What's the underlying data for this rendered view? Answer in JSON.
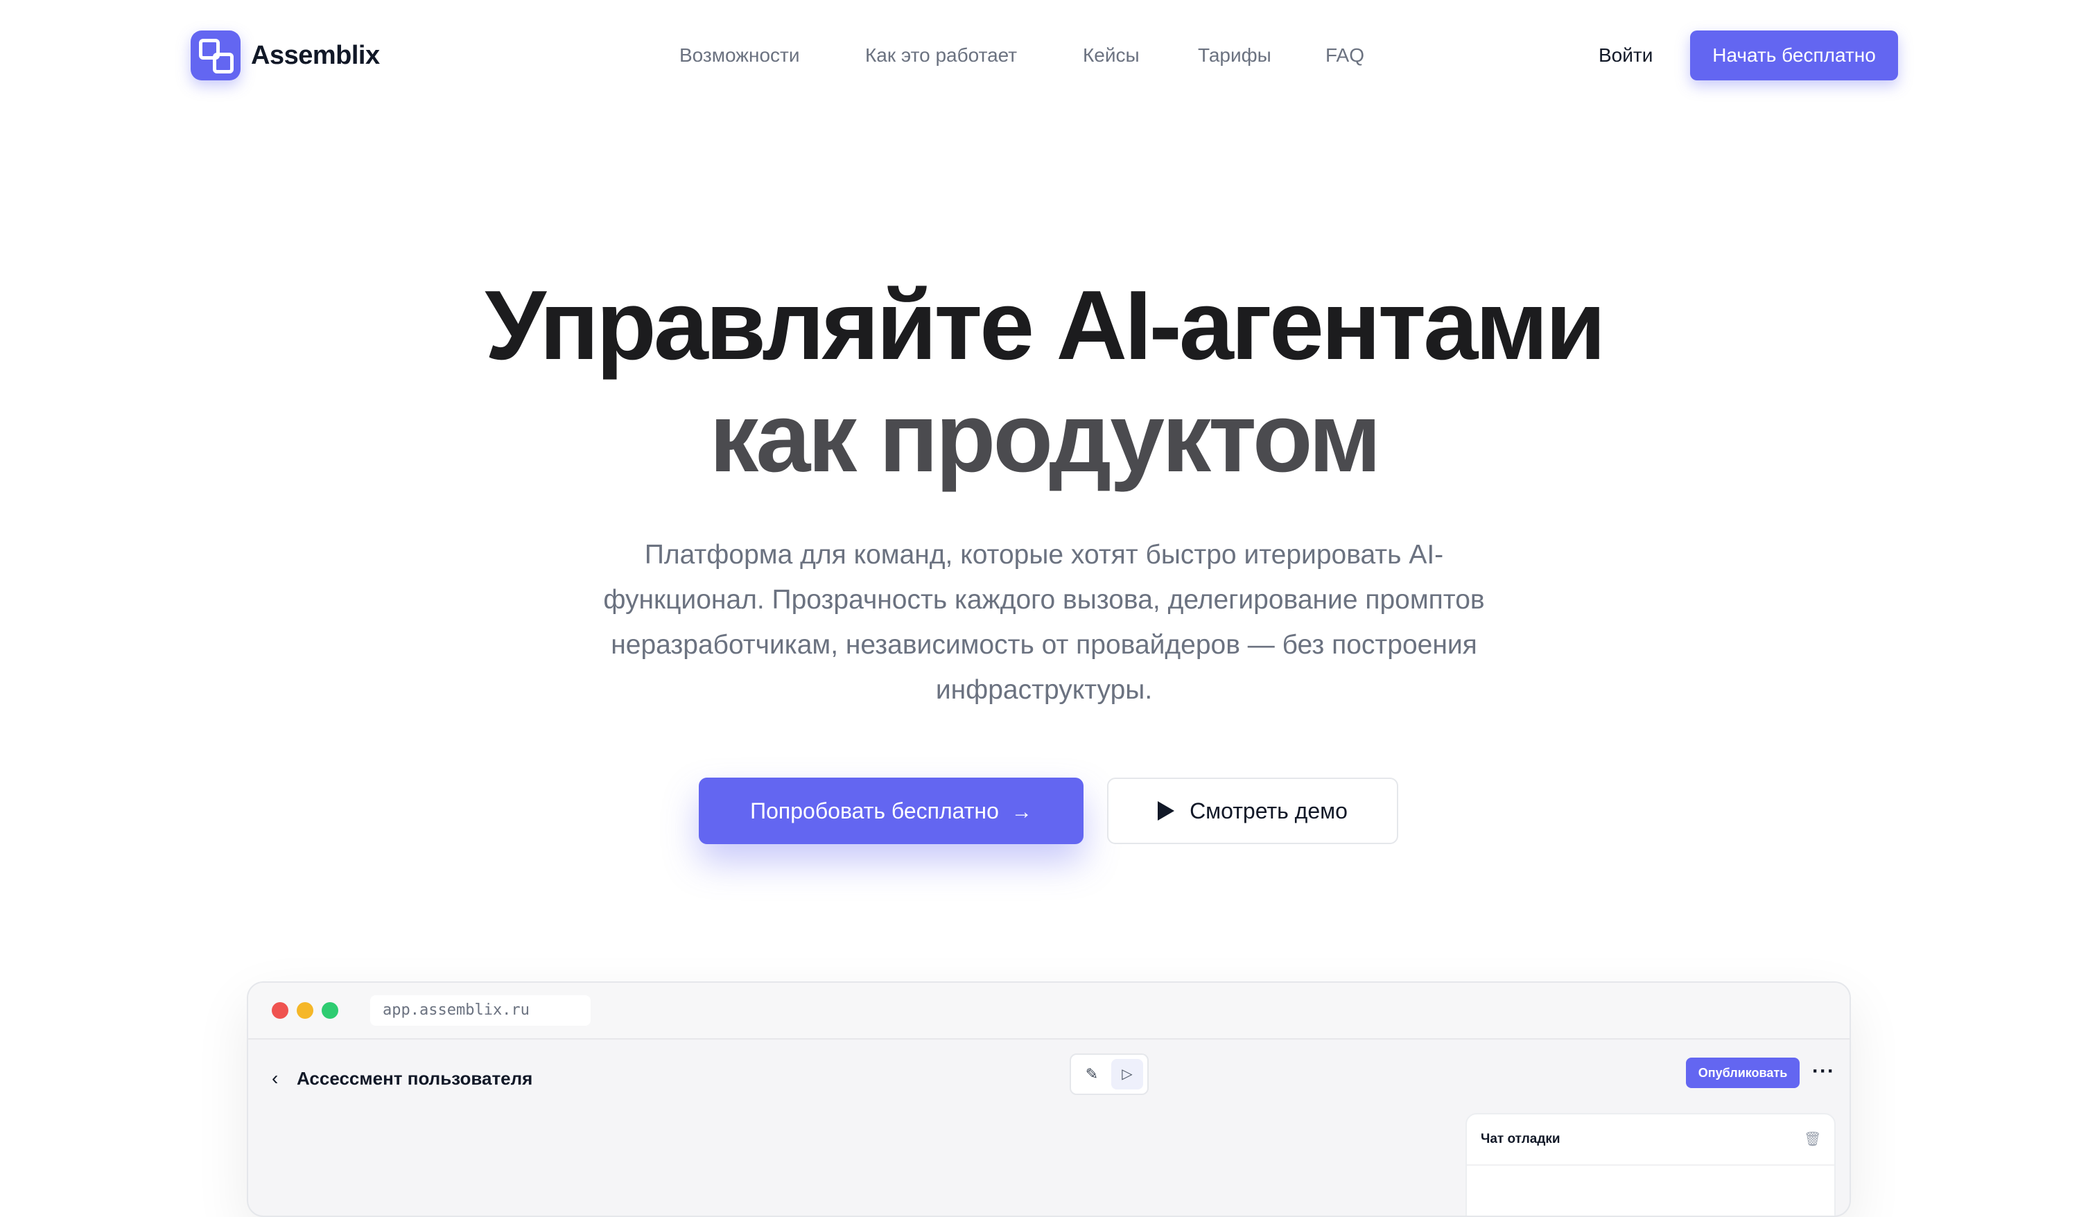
{
  "header": {
    "brand": "Assemblix",
    "nav": [
      {
        "label": "Возможности"
      },
      {
        "label": "Как это работает"
      },
      {
        "label": "Кейсы"
      },
      {
        "label": "Тарифы"
      },
      {
        "label": "FAQ"
      }
    ],
    "login_label": "Войти",
    "cta_label": "Начать бесплатно"
  },
  "hero": {
    "title_line1": "Управляйте AI-агентами",
    "title_line2": "как продуктом",
    "subtitle": "Платформа для команд, которые хотят быстро итерировать AI-функционал. Прозрачность каждого вызова, делегирование промптов неразработчикам, независимость от провайдеров — без построения инфраструктуры.",
    "primary_button": "Попробовать бесплатно",
    "primary_button_icon": "arrow-right-icon",
    "secondary_button": "Смотреть демо",
    "secondary_button_icon": "play-icon"
  },
  "app_preview": {
    "url": "app.assemblix.ru",
    "page_title": "Ассессмент пользователя",
    "publish_label": "Опубликовать",
    "debug_panel_title": "Чат отладки",
    "icons": [
      "back-chevron-icon",
      "edit-icon",
      "run-icon",
      "more-icon",
      "trash-icon"
    ]
  },
  "colors": {
    "accent": "#6366f1",
    "title_dark": "#1c1c1e",
    "title_muted": "#4b4b4f",
    "text_muted": "#6b7280"
  }
}
